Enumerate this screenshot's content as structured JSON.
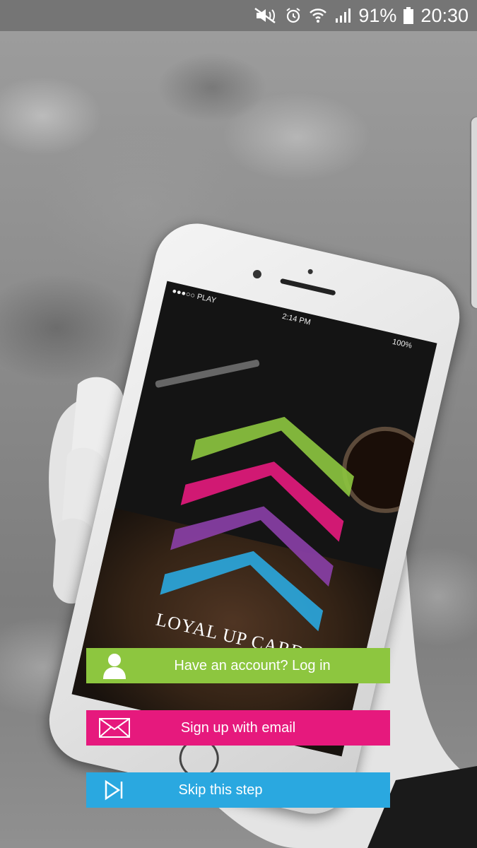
{
  "status_bar": {
    "battery_percent": "91%",
    "time": "20:30"
  },
  "phone_mockup": {
    "carrier": "●●●○○ PLAY",
    "time": "2:14 PM",
    "battery": "100%",
    "brand_name": "LOYAL UP CARD"
  },
  "buttons": {
    "login_label": "Have an account? Log in",
    "signup_label": "Sign up with email",
    "skip_label": "Skip this step"
  },
  "colors": {
    "login": "#8dc63f",
    "signup": "#e6197d",
    "skip": "#2aa8e0",
    "chevron_green": "#8dc63f",
    "chevron_pink": "#e6197d",
    "chevron_purple": "#8b3fa8",
    "chevron_blue": "#2aa8e0"
  }
}
